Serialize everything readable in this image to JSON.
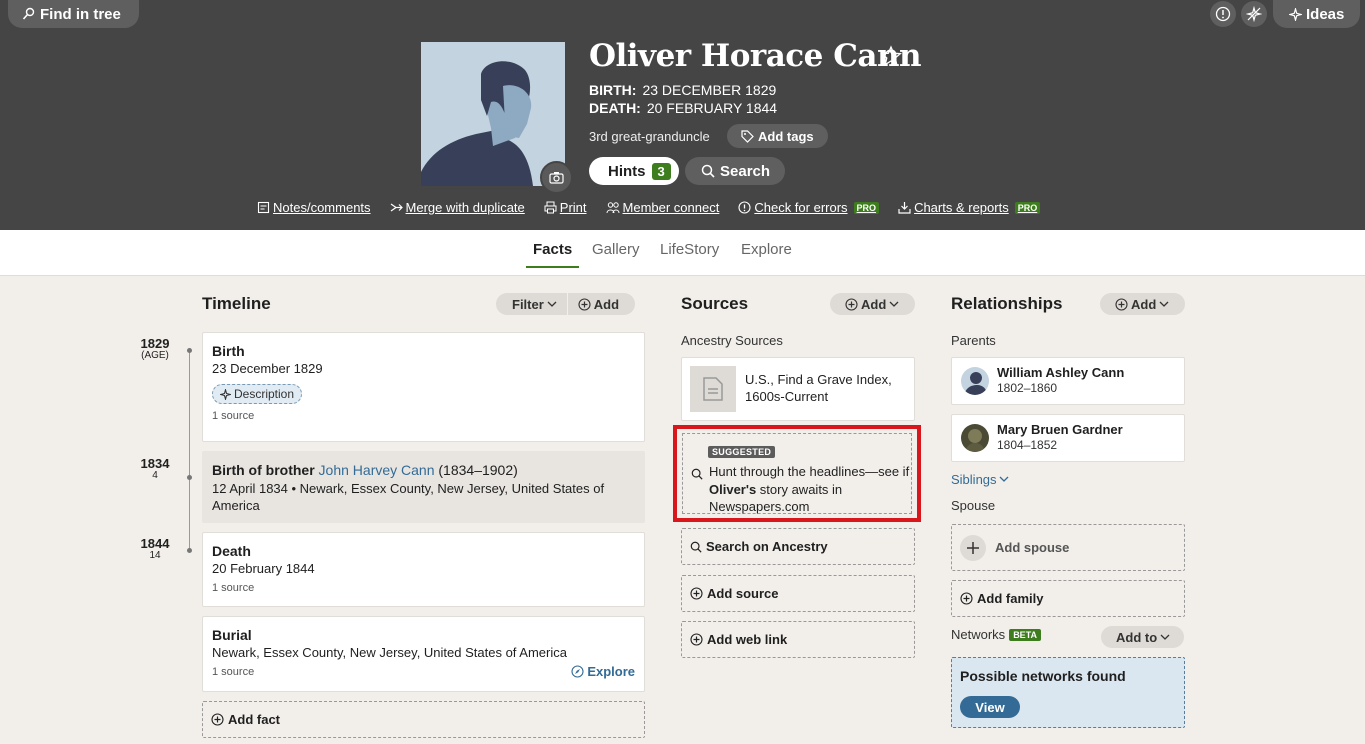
{
  "header": {
    "find_in_tree": "Find in tree",
    "ideas": "Ideas",
    "person_name": "Oliver Horace Cann",
    "birth_label": "BIRTH:",
    "birth_value": "23 DECEMBER 1829",
    "death_label": "DEATH:",
    "death_value": "20 FEBRUARY 1844",
    "relationship": "3rd great-granduncle",
    "add_tags": "Add tags",
    "hints_label": "Hints",
    "hints_count": "3",
    "search_label": "Search",
    "actions": {
      "notes": "Notes/comments",
      "merge": "Merge with duplicate",
      "print": "Print",
      "member_connect": "Member connect",
      "check_errors": "Check for errors",
      "charts_reports": "Charts & reports",
      "pro": "PRO"
    }
  },
  "tabs": [
    "Facts",
    "Gallery",
    "LifeStory",
    "Explore"
  ],
  "active_tab": "Facts",
  "timeline": {
    "title": "Timeline",
    "filter": "Filter",
    "add": "Add",
    "events": [
      {
        "year": "1829",
        "age": "(AGE)",
        "title": "Birth",
        "date": "23 December 1829",
        "tag": "Description",
        "sources": "1 source"
      },
      {
        "year": "1834",
        "age": "4",
        "title_prefix": "Birth of brother ",
        "person_link": "John Harvey Cann",
        "title_suffix": " (1834–1902)",
        "detail": "12 April 1834 • Newark, Essex County, New Jersey, United States of America"
      },
      {
        "year": "1844",
        "age": "14",
        "title": "Death",
        "date": "20 February 1844",
        "sources": "1 source"
      },
      {
        "title": "Burial",
        "place": "Newark, Essex County, New Jersey, United States of America",
        "sources": "1 source",
        "explore": "Explore"
      }
    ],
    "add_fact": "Add fact"
  },
  "sources": {
    "title": "Sources",
    "add": "Add",
    "ancestry_sources": "Ancestry Sources",
    "record_title": "U.S., Find a Grave Index, 1600s-Current",
    "suggested_badge": "SUGGESTED",
    "suggested_text_1": "Hunt through the headlines—see if ",
    "suggested_bold": "Oliver's",
    "suggested_text_2": " story awaits in Newspapers.com",
    "search_ancestry": "Search on Ancestry",
    "add_source": "Add source",
    "add_web_link": "Add web link"
  },
  "relationships": {
    "title": "Relationships",
    "add": "Add",
    "parents_label": "Parents",
    "parents": [
      {
        "name": "William Ashley Cann",
        "dates": "1802–1860"
      },
      {
        "name": "Mary Bruen Gardner",
        "dates": "1804–1852"
      }
    ],
    "siblings": "Siblings",
    "spouse_label": "Spouse",
    "add_spouse": "Add spouse",
    "add_family": "Add family",
    "networks_label": "Networks",
    "beta": "BETA",
    "add_to": "Add to",
    "networks_found": "Possible networks found",
    "view": "View"
  },
  "colors": {
    "header_bg": "#454545",
    "accent_green": "#3d7d1e",
    "link_blue": "#336b96",
    "highlight_red": "#d9161c"
  }
}
